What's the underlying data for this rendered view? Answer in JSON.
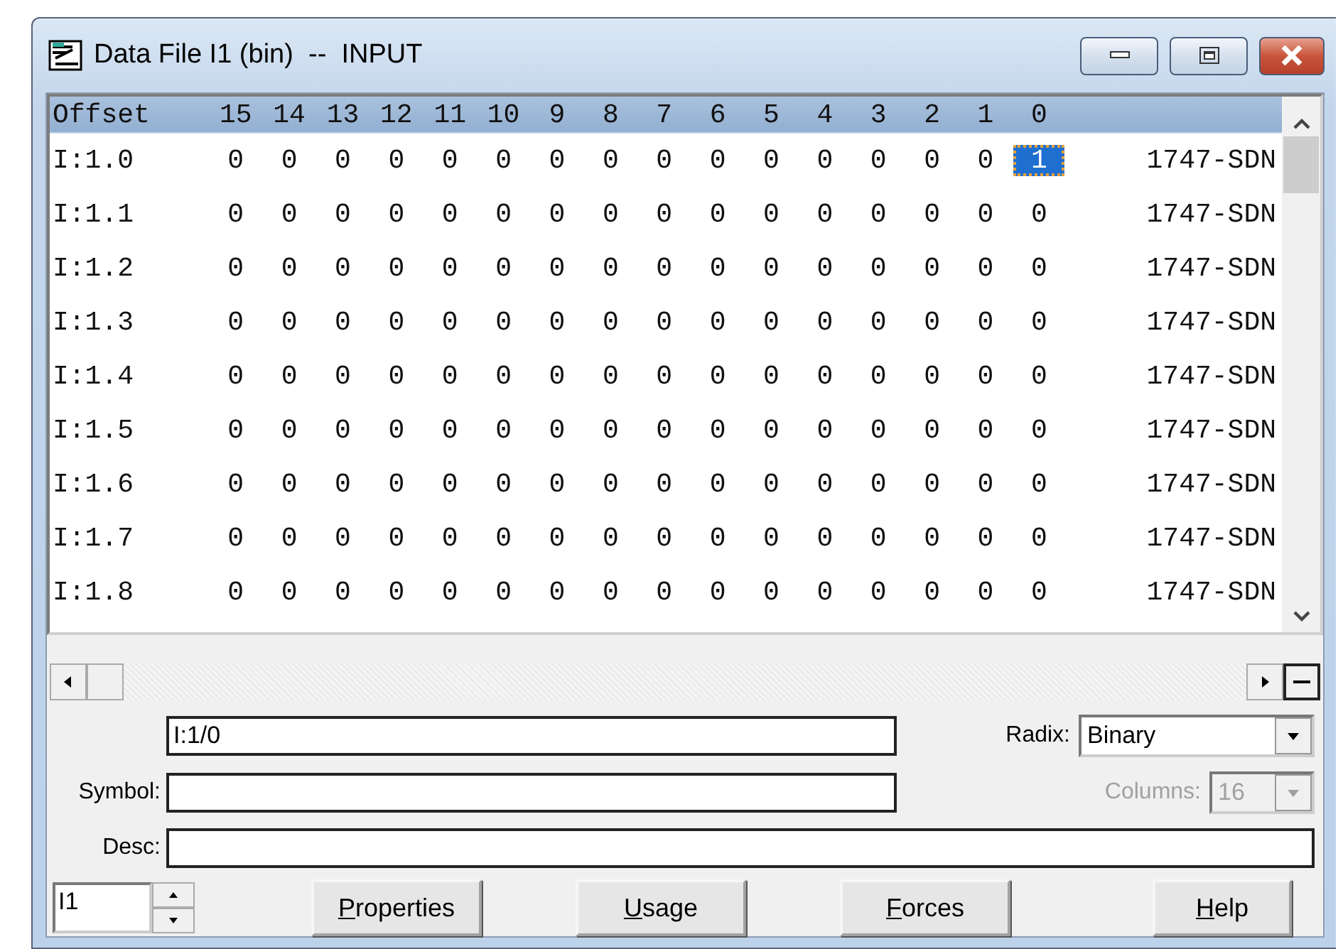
{
  "window": {
    "title": "Data File I1 (bin)  --  INPUT"
  },
  "table": {
    "columns": [
      "Offset",
      "15",
      "14",
      "13",
      "12",
      "11",
      "10",
      "9",
      "8",
      "7",
      "6",
      "5",
      "4",
      "3",
      "2",
      "1",
      "0"
    ],
    "rows": [
      {
        "offset": "I:1.0",
        "bits": [
          {
            "value": "0",
            "selected": false
          },
          {
            "value": "0",
            "selected": false
          },
          {
            "value": "0",
            "selected": false
          },
          {
            "value": "0",
            "selected": false
          },
          {
            "value": "0",
            "selected": false
          },
          {
            "value": "0",
            "selected": false
          },
          {
            "value": "0",
            "selected": false
          },
          {
            "value": "0",
            "selected": false
          },
          {
            "value": "0",
            "selected": false
          },
          {
            "value": "0",
            "selected": false
          },
          {
            "value": "0",
            "selected": false
          },
          {
            "value": "0",
            "selected": false
          },
          {
            "value": "0",
            "selected": false
          },
          {
            "value": "0",
            "selected": false
          },
          {
            "value": "0",
            "selected": false
          },
          {
            "value": "1",
            "selected": true
          }
        ],
        "module": "1747-SDN"
      },
      {
        "offset": "I:1.1",
        "bits": [
          {
            "value": "0",
            "selected": false
          },
          {
            "value": "0",
            "selected": false
          },
          {
            "value": "0",
            "selected": false
          },
          {
            "value": "0",
            "selected": false
          },
          {
            "value": "0",
            "selected": false
          },
          {
            "value": "0",
            "selected": false
          },
          {
            "value": "0",
            "selected": false
          },
          {
            "value": "0",
            "selected": false
          },
          {
            "value": "0",
            "selected": false
          },
          {
            "value": "0",
            "selected": false
          },
          {
            "value": "0",
            "selected": false
          },
          {
            "value": "0",
            "selected": false
          },
          {
            "value": "0",
            "selected": false
          },
          {
            "value": "0",
            "selected": false
          },
          {
            "value": "0",
            "selected": false
          },
          {
            "value": "0",
            "selected": false
          }
        ],
        "module": "1747-SDN"
      },
      {
        "offset": "I:1.2",
        "bits": [
          {
            "value": "0",
            "selected": false
          },
          {
            "value": "0",
            "selected": false
          },
          {
            "value": "0",
            "selected": false
          },
          {
            "value": "0",
            "selected": false
          },
          {
            "value": "0",
            "selected": false
          },
          {
            "value": "0",
            "selected": false
          },
          {
            "value": "0",
            "selected": false
          },
          {
            "value": "0",
            "selected": false
          },
          {
            "value": "0",
            "selected": false
          },
          {
            "value": "0",
            "selected": false
          },
          {
            "value": "0",
            "selected": false
          },
          {
            "value": "0",
            "selected": false
          },
          {
            "value": "0",
            "selected": false
          },
          {
            "value": "0",
            "selected": false
          },
          {
            "value": "0",
            "selected": false
          },
          {
            "value": "0",
            "selected": false
          }
        ],
        "module": "1747-SDN"
      },
      {
        "offset": "I:1.3",
        "bits": [
          {
            "value": "0",
            "selected": false
          },
          {
            "value": "0",
            "selected": false
          },
          {
            "value": "0",
            "selected": false
          },
          {
            "value": "0",
            "selected": false
          },
          {
            "value": "0",
            "selected": false
          },
          {
            "value": "0",
            "selected": false
          },
          {
            "value": "0",
            "selected": false
          },
          {
            "value": "0",
            "selected": false
          },
          {
            "value": "0",
            "selected": false
          },
          {
            "value": "0",
            "selected": false
          },
          {
            "value": "0",
            "selected": false
          },
          {
            "value": "0",
            "selected": false
          },
          {
            "value": "0",
            "selected": false
          },
          {
            "value": "0",
            "selected": false
          },
          {
            "value": "0",
            "selected": false
          },
          {
            "value": "0",
            "selected": false
          }
        ],
        "module": "1747-SDN"
      },
      {
        "offset": "I:1.4",
        "bits": [
          {
            "value": "0",
            "selected": false
          },
          {
            "value": "0",
            "selected": false
          },
          {
            "value": "0",
            "selected": false
          },
          {
            "value": "0",
            "selected": false
          },
          {
            "value": "0",
            "selected": false
          },
          {
            "value": "0",
            "selected": false
          },
          {
            "value": "0",
            "selected": false
          },
          {
            "value": "0",
            "selected": false
          },
          {
            "value": "0",
            "selected": false
          },
          {
            "value": "0",
            "selected": false
          },
          {
            "value": "0",
            "selected": false
          },
          {
            "value": "0",
            "selected": false
          },
          {
            "value": "0",
            "selected": false
          },
          {
            "value": "0",
            "selected": false
          },
          {
            "value": "0",
            "selected": false
          },
          {
            "value": "0",
            "selected": false
          }
        ],
        "module": "1747-SDN"
      },
      {
        "offset": "I:1.5",
        "bits": [
          {
            "value": "0",
            "selected": false
          },
          {
            "value": "0",
            "selected": false
          },
          {
            "value": "0",
            "selected": false
          },
          {
            "value": "0",
            "selected": false
          },
          {
            "value": "0",
            "selected": false
          },
          {
            "value": "0",
            "selected": false
          },
          {
            "value": "0",
            "selected": false
          },
          {
            "value": "0",
            "selected": false
          },
          {
            "value": "0",
            "selected": false
          },
          {
            "value": "0",
            "selected": false
          },
          {
            "value": "0",
            "selected": false
          },
          {
            "value": "0",
            "selected": false
          },
          {
            "value": "0",
            "selected": false
          },
          {
            "value": "0",
            "selected": false
          },
          {
            "value": "0",
            "selected": false
          },
          {
            "value": "0",
            "selected": false
          }
        ],
        "module": "1747-SDN"
      },
      {
        "offset": "I:1.6",
        "bits": [
          {
            "value": "0",
            "selected": false
          },
          {
            "value": "0",
            "selected": false
          },
          {
            "value": "0",
            "selected": false
          },
          {
            "value": "0",
            "selected": false
          },
          {
            "value": "0",
            "selected": false
          },
          {
            "value": "0",
            "selected": false
          },
          {
            "value": "0",
            "selected": false
          },
          {
            "value": "0",
            "selected": false
          },
          {
            "value": "0",
            "selected": false
          },
          {
            "value": "0",
            "selected": false
          },
          {
            "value": "0",
            "selected": false
          },
          {
            "value": "0",
            "selected": false
          },
          {
            "value": "0",
            "selected": false
          },
          {
            "value": "0",
            "selected": false
          },
          {
            "value": "0",
            "selected": false
          },
          {
            "value": "0",
            "selected": false
          }
        ],
        "module": "1747-SDN"
      },
      {
        "offset": "I:1.7",
        "bits": [
          {
            "value": "0",
            "selected": false
          },
          {
            "value": "0",
            "selected": false
          },
          {
            "value": "0",
            "selected": false
          },
          {
            "value": "0",
            "selected": false
          },
          {
            "value": "0",
            "selected": false
          },
          {
            "value": "0",
            "selected": false
          },
          {
            "value": "0",
            "selected": false
          },
          {
            "value": "0",
            "selected": false
          },
          {
            "value": "0",
            "selected": false
          },
          {
            "value": "0",
            "selected": false
          },
          {
            "value": "0",
            "selected": false
          },
          {
            "value": "0",
            "selected": false
          },
          {
            "value": "0",
            "selected": false
          },
          {
            "value": "0",
            "selected": false
          },
          {
            "value": "0",
            "selected": false
          },
          {
            "value": "0",
            "selected": false
          }
        ],
        "module": "1747-SDN"
      },
      {
        "offset": "I:1.8",
        "bits": [
          {
            "value": "0",
            "selected": false
          },
          {
            "value": "0",
            "selected": false
          },
          {
            "value": "0",
            "selected": false
          },
          {
            "value": "0",
            "selected": false
          },
          {
            "value": "0",
            "selected": false
          },
          {
            "value": "0",
            "selected": false
          },
          {
            "value": "0",
            "selected": false
          },
          {
            "value": "0",
            "selected": false
          },
          {
            "value": "0",
            "selected": false
          },
          {
            "value": "0",
            "selected": false
          },
          {
            "value": "0",
            "selected": false
          },
          {
            "value": "0",
            "selected": false
          },
          {
            "value": "0",
            "selected": false
          },
          {
            "value": "0",
            "selected": false
          },
          {
            "value": "0",
            "selected": false
          },
          {
            "value": "0",
            "selected": false
          }
        ],
        "module": "1747-SDN"
      }
    ]
  },
  "address": {
    "value": "I:1/0"
  },
  "symbol": {
    "label": "Symbol:"
  },
  "desc": {
    "label": "Desc:"
  },
  "radix": {
    "label": "Radix:",
    "value": "Binary"
  },
  "columns": {
    "label": "Columns:",
    "value": "16",
    "disabled": true
  },
  "file_spinner": {
    "value": "I1"
  },
  "buttons": [
    {
      "mnemonic": "P",
      "rest": "roperties"
    },
    {
      "mnemonic": "U",
      "rest": "sage"
    },
    {
      "mnemonic": "F",
      "rest": "orces"
    },
    {
      "mnemonic": "H",
      "rest": "elp"
    }
  ]
}
